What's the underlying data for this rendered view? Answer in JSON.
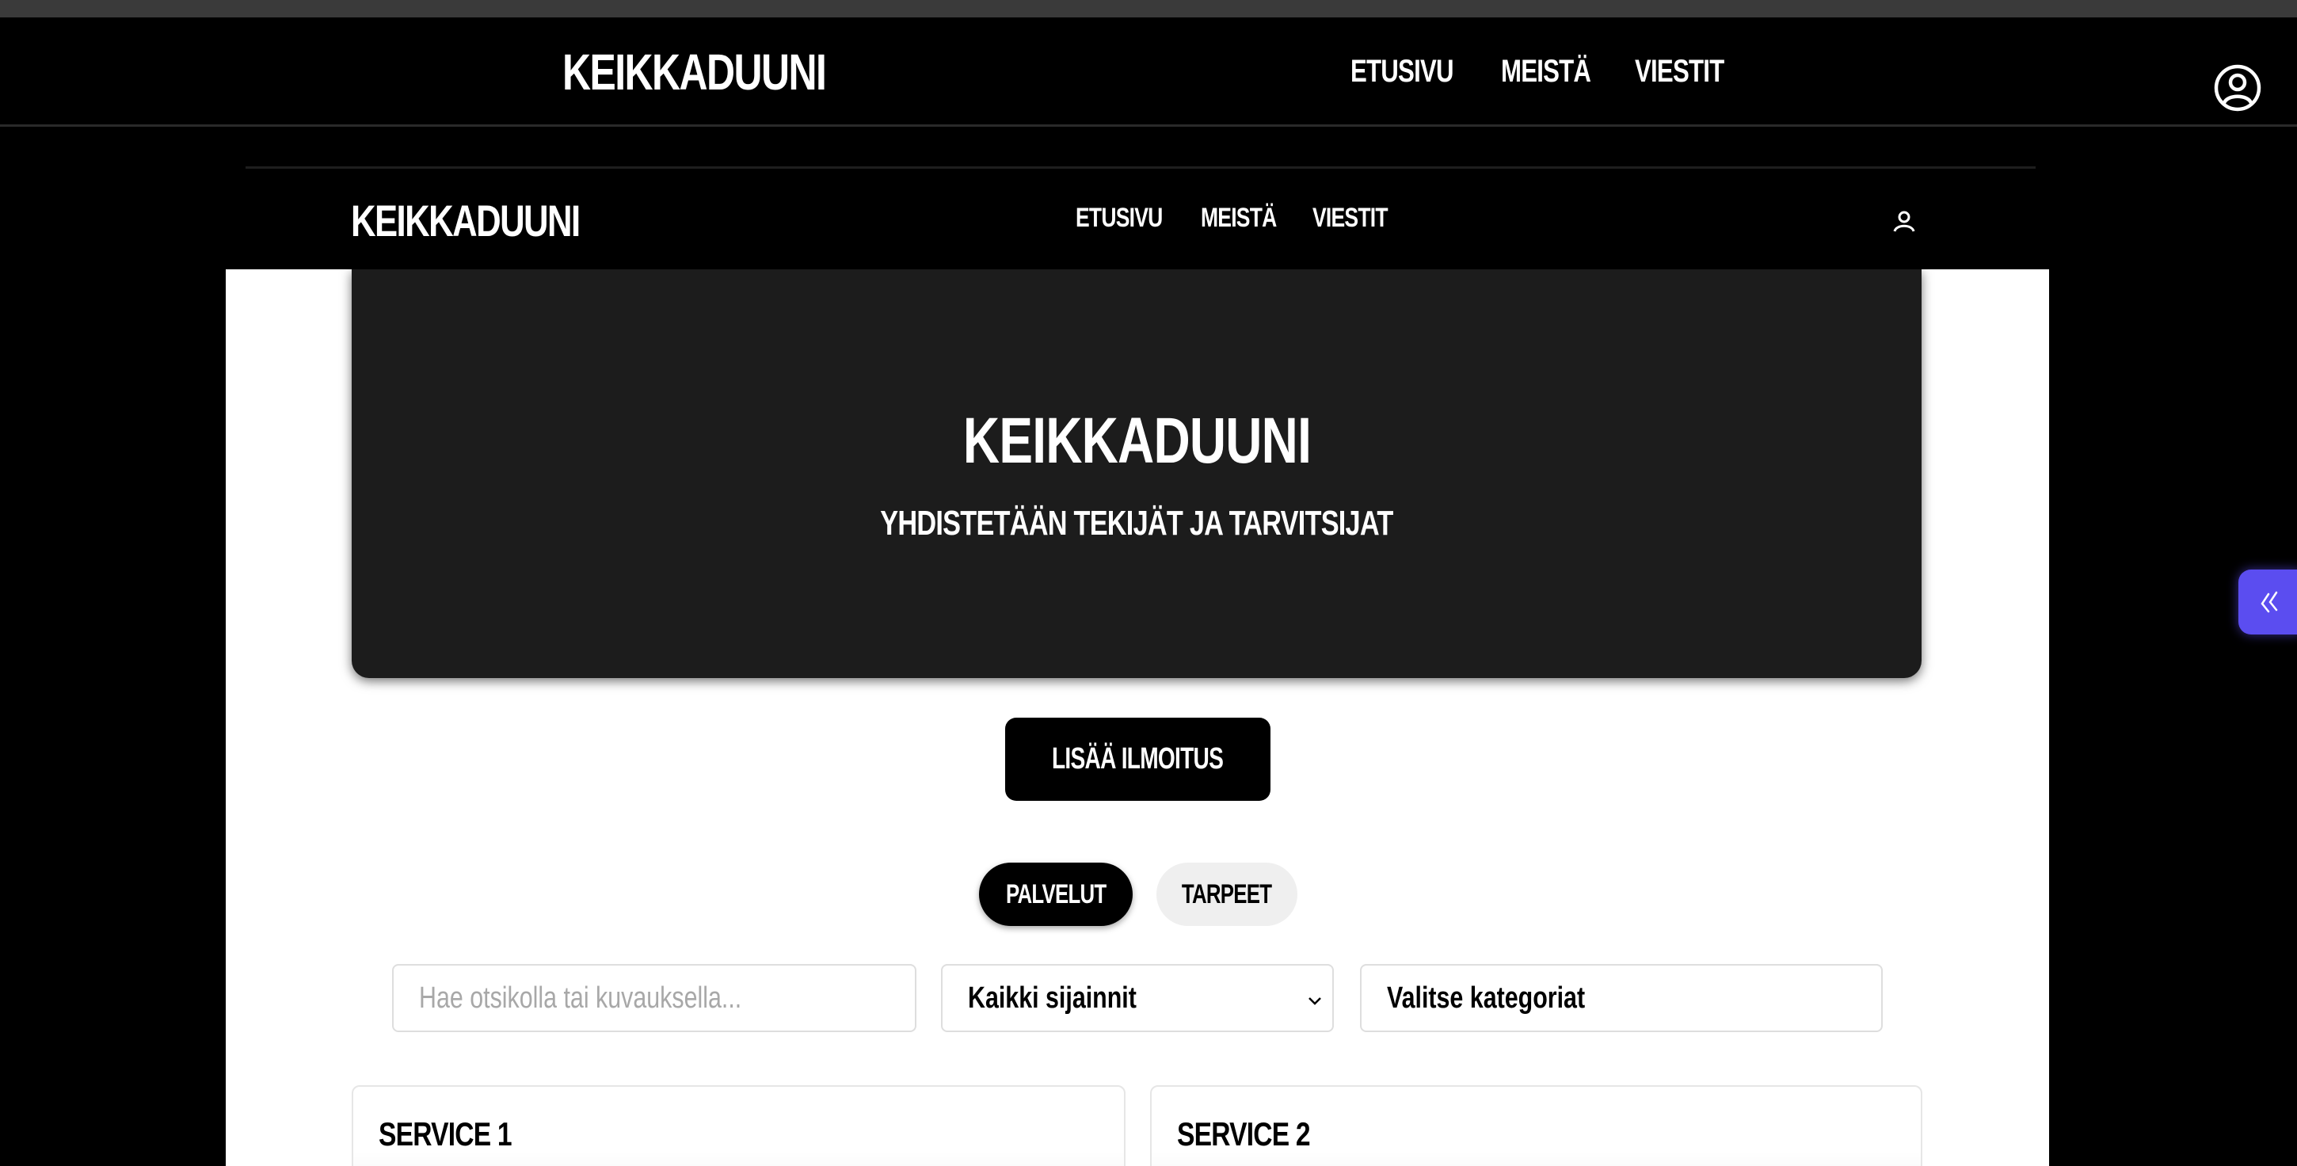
{
  "outer_nav": {
    "logo": "KEIKKADUUNI",
    "links": [
      "ETUSIVU",
      "MEISTÄ",
      "VIESTIT"
    ],
    "user_icon": "user-circle-icon"
  },
  "inner_nav": {
    "logo": "KEIKKADUUNI",
    "links": [
      "ETUSIVU",
      "MEISTÄ",
      "VIESTIT"
    ],
    "user_icon": "user-icon"
  },
  "hero": {
    "title": "KEIKKADUUNI",
    "subtitle": "YHDISTETÄÄN TEKIJÄT JA TARVITSIJAT"
  },
  "actions": {
    "add_listing": "LISÄÄ ILMOITUS"
  },
  "tabs": [
    {
      "label": "PALVELUT",
      "active": true
    },
    {
      "label": "TARPEET",
      "active": false
    }
  ],
  "filters": {
    "search_placeholder": "Hae otsikolla tai kuvauksella...",
    "location_selected": "Kaikki sijainnit",
    "category_placeholder": "Valitse kategoriat"
  },
  "cards": [
    {
      "title": "SERVICE 1"
    },
    {
      "title": "SERVICE 2"
    }
  ],
  "side_widget": {
    "icon": "double-chevron-left-icon",
    "color": "#5b4df0"
  }
}
